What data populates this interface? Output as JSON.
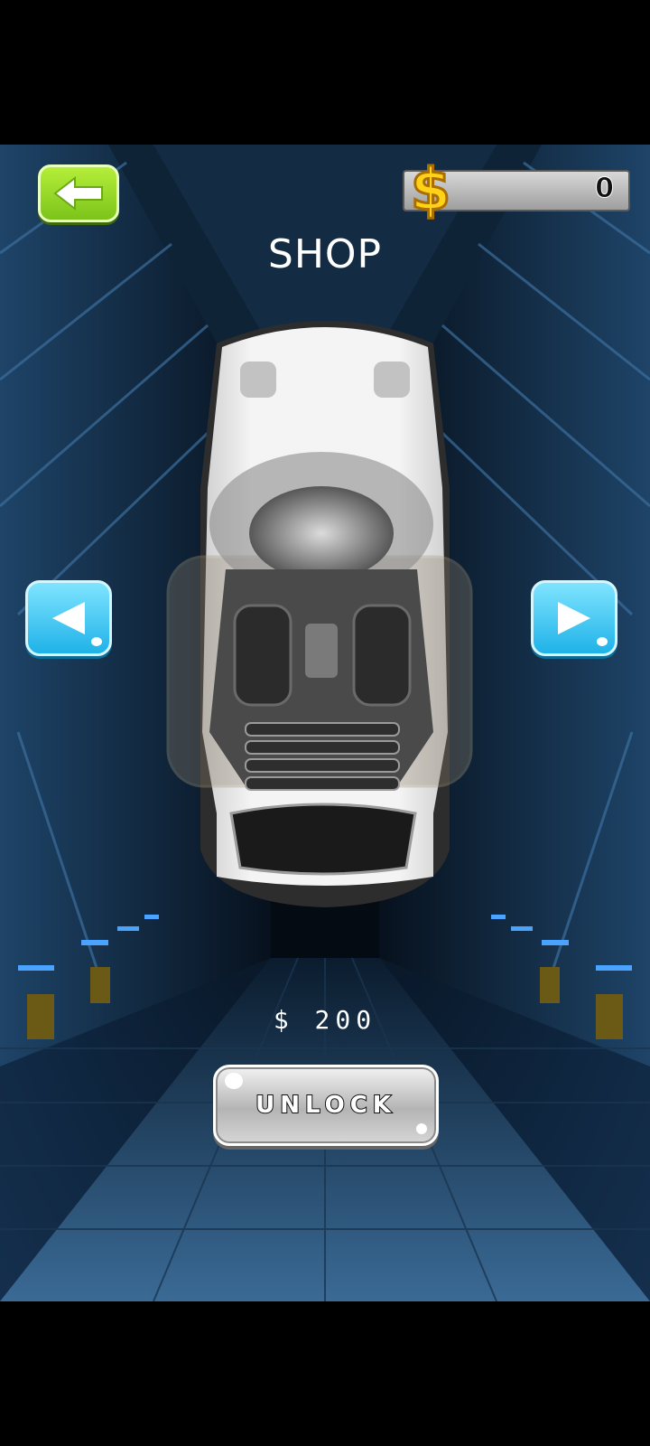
{
  "header": {
    "title": "SHOP"
  },
  "wallet": {
    "coins": "0",
    "currency_icon": "dollar-icon"
  },
  "navigation": {
    "back_icon": "arrow-left-icon",
    "prev_icon": "triangle-left-icon",
    "next_icon": "triangle-right-icon"
  },
  "item": {
    "name": "white convertible car",
    "price": "$ 200"
  },
  "actions": {
    "unlock_label": "UNLOCK"
  },
  "colors": {
    "back_button": "#8fd422",
    "arrow_buttons": "#2dbdf0",
    "unlock_button": "#c8c8c8"
  }
}
